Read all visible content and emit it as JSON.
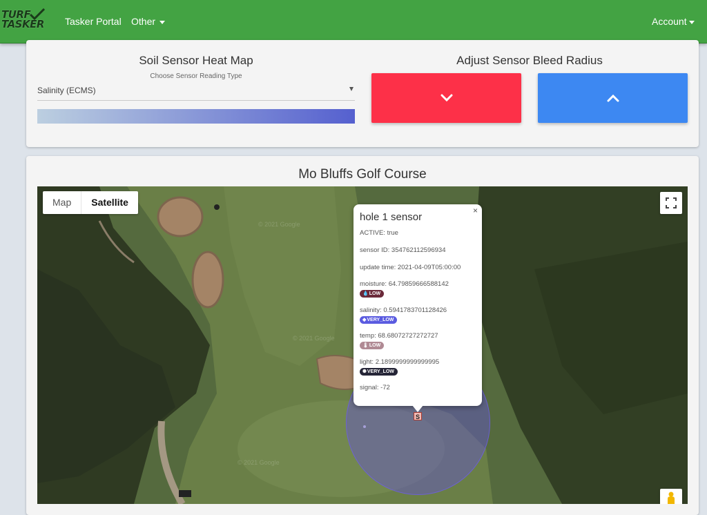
{
  "navbar": {
    "logo_line1": "TURF",
    "logo_line2": "TASKER",
    "links": [
      "Tasker Portal",
      "Other"
    ],
    "account": "Account"
  },
  "heatmap": {
    "title": "Soil Sensor Heat Map",
    "choose_label": "Choose Sensor Reading Type",
    "selected": "Salinity (ECMS)"
  },
  "bleed": {
    "title": "Adjust Sensor Bleed Radius",
    "down_icon": "chevron-down-icon",
    "up_icon": "chevron-up-icon"
  },
  "course": {
    "title": "Mo Bluffs Golf Course"
  },
  "map": {
    "toggle": [
      "Map",
      "Satellite"
    ],
    "active_toggle": "Satellite",
    "marker_label": "S",
    "watermarks": [
      "© 2021 Google",
      "© 2021 Google",
      "© 2021 Google"
    ]
  },
  "infowindow": {
    "title": "hole 1 sensor",
    "active": "ACTIVE: true",
    "sensor_id": "sensor ID: 354762112596934",
    "update_time": "update time: 2021-04-09T05:00:00",
    "moisture": "moisture: 64.79859666588142",
    "moisture_badge": "LOW",
    "salinity": "salinity: 0.5941783701128426",
    "salinity_badge": "VERY_LOW",
    "temp": "temp: 68.68072727272727",
    "temp_badge": "LOW",
    "light": "light: 2.1899999999999995",
    "light_badge": "VERY_LOW",
    "signal": "signal: -72",
    "close": "×"
  },
  "colors": {
    "navbar": "#43a343",
    "down_button": "#fd3048",
    "up_button": "#3d88f2",
    "gradient_start": "#bccfe0",
    "gradient_end": "#5560cf",
    "moisture_badge": "#6b2a3a",
    "salinity_badge": "#5a5be0",
    "temp_badge": "#b08a94",
    "light_badge": "#252537"
  }
}
